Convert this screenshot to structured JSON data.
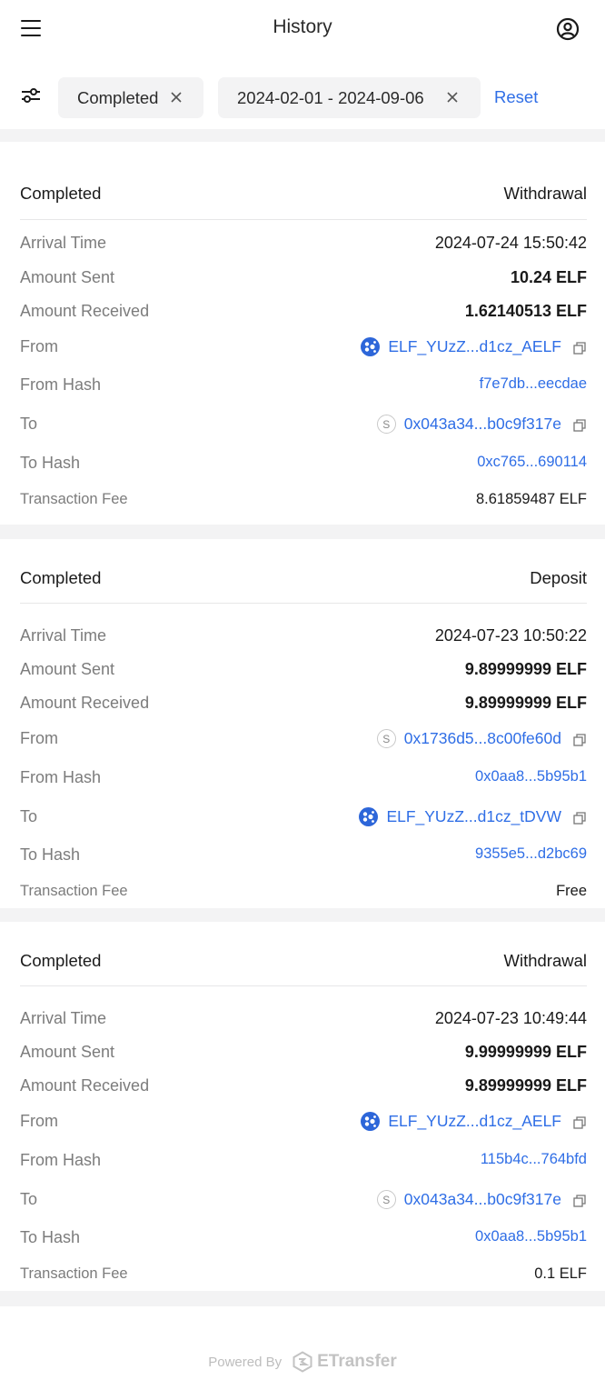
{
  "header": {
    "title": "History"
  },
  "filters": {
    "status": "Completed",
    "date_range": "2024-02-01 - 2024-09-06",
    "reset_label": "Reset"
  },
  "labels": {
    "arrival_time": "Arrival Time",
    "amount_sent": "Amount Sent",
    "amount_received": "Amount Received",
    "from": "From",
    "from_hash": "From Hash",
    "to": "To",
    "to_hash": "To Hash",
    "transaction_fee": "Transaction Fee"
  },
  "transactions": [
    {
      "status": "Completed",
      "type": "Withdrawal",
      "arrival_time": "2024-07-24 15:50:42",
      "amount_sent": "10.24 ELF",
      "amount_received": "1.62140513 ELF",
      "from": "ELF_YUzZ...d1cz_AELF",
      "from_chain_icon": "aelf-chain-icon",
      "from_hash": "f7e7db...eecdae",
      "to": "0x043a34...b0c9f317e",
      "to_chain_icon": "s-chain-icon",
      "to_hash": "0xc765...690114",
      "fee": "8.61859487 ELF"
    },
    {
      "status": "Completed",
      "type": "Deposit",
      "arrival_time": "2024-07-23 10:50:22",
      "amount_sent": "9.89999999 ELF",
      "amount_received": "9.89999999 ELF",
      "from": "0x1736d5...8c00fe60d",
      "from_chain_icon": "s-chain-icon",
      "from_hash": "0x0aa8...5b95b1",
      "to": "ELF_YUzZ...d1cz_tDVW",
      "to_chain_icon": "aelf-chain-icon",
      "to_hash": "9355e5...d2bc69",
      "fee": "Free"
    },
    {
      "status": "Completed",
      "type": "Withdrawal",
      "arrival_time": "2024-07-23 10:49:44",
      "amount_sent": "9.99999999 ELF",
      "amount_received": "9.89999999 ELF",
      "from": "ELF_YUzZ...d1cz_AELF",
      "from_chain_icon": "aelf-chain-icon",
      "from_hash": "115b4c...764bfd",
      "to": "0x043a34...b0c9f317e",
      "to_chain_icon": "s-chain-icon",
      "to_hash": "0x0aa8...5b95b1",
      "fee": "0.1 ELF"
    }
  ],
  "chain_badge_letter": "S",
  "footer": {
    "powered_by": "Powered By",
    "brand": "ETransfer"
  },
  "colors": {
    "accent": "#2f6ee6",
    "background": "#f3f3f4",
    "card": "#ffffff",
    "muted_text": "#7c7c7c"
  }
}
